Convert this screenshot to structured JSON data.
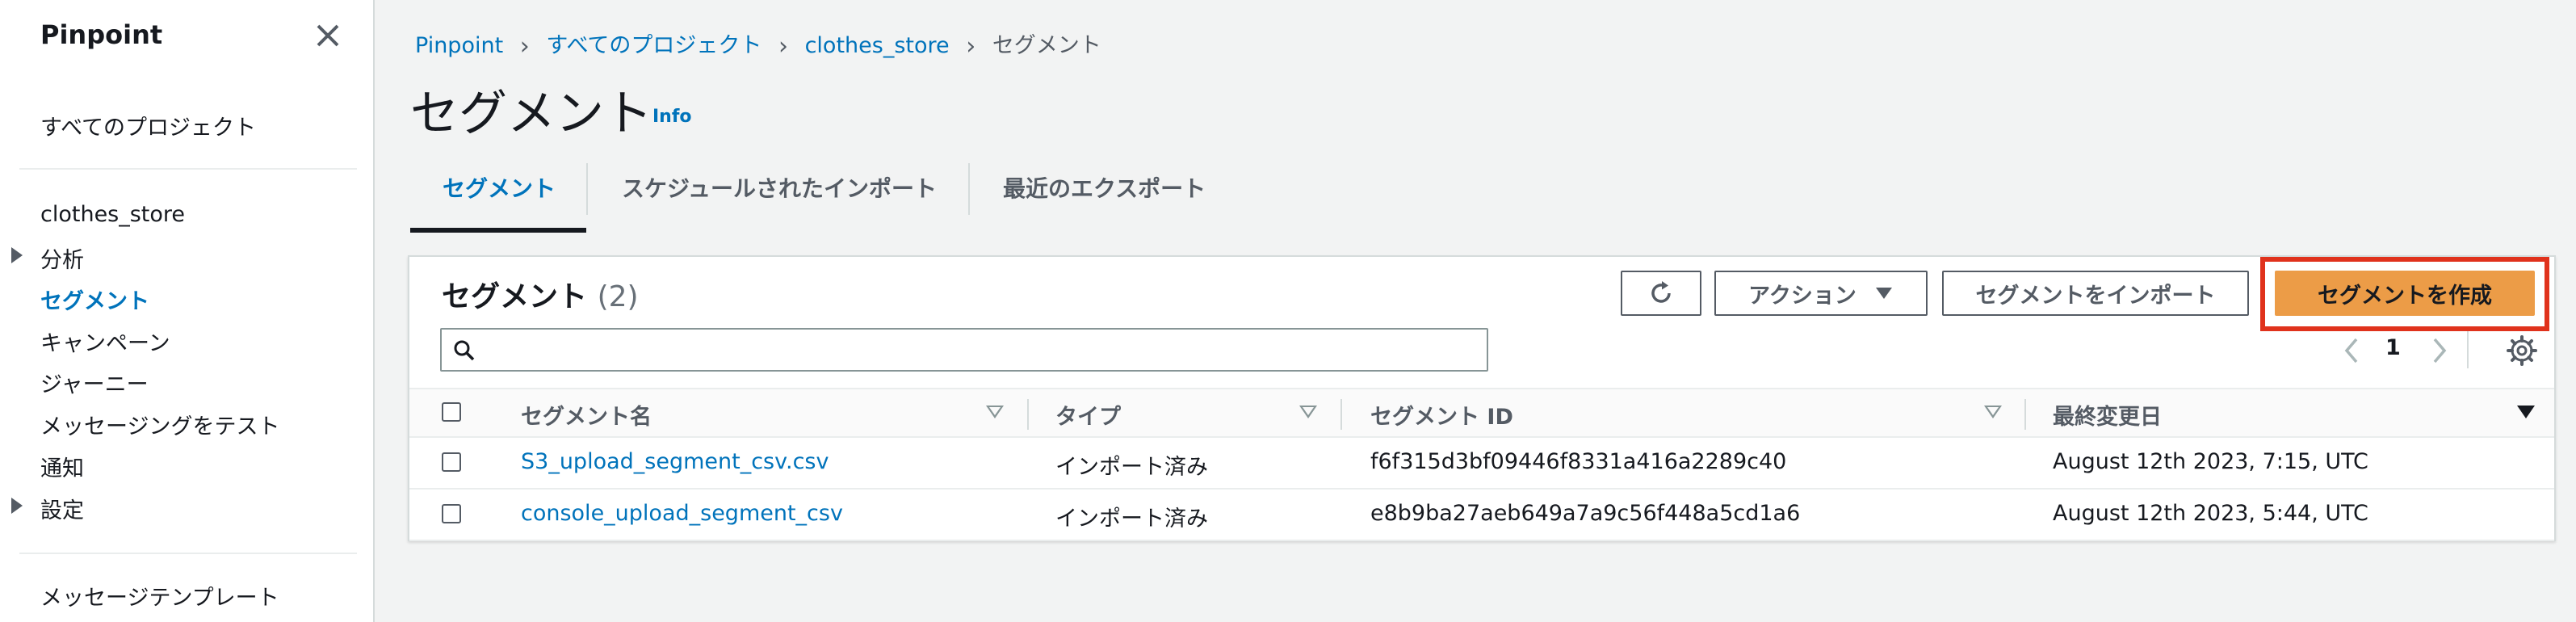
{
  "sidebar": {
    "title": "Pinpoint",
    "all_projects": "すべてのプロジェクト",
    "project_name": "clothes_store",
    "items": [
      {
        "label": "分析",
        "expandable": true
      },
      {
        "label": "セグメント",
        "active": true
      },
      {
        "label": "キャンペーン"
      },
      {
        "label": "ジャーニー"
      },
      {
        "label": "メッセージングをテスト"
      },
      {
        "label": "通知"
      },
      {
        "label": "設定",
        "expandable": true
      }
    ],
    "templates": "メッセージテンプレート"
  },
  "breadcrumb": [
    "Pinpoint",
    "すべてのプロジェクト",
    "clothes_store",
    "セグメント"
  ],
  "page": {
    "title": "セグメント",
    "info": "Info"
  },
  "tabs": [
    {
      "label": "セグメント",
      "active": true
    },
    {
      "label": "スケジュールされたインポート"
    },
    {
      "label": "最近のエクスポート"
    }
  ],
  "panel": {
    "title": "セグメント",
    "count": "(2)",
    "actions_label": "アクション",
    "import_label": "セグメントをインポート",
    "create_label": "セグメントを作成",
    "search_placeholder": "",
    "page_number": "1"
  },
  "table": {
    "columns": [
      "セグメント名",
      "タイプ",
      "セグメント ID",
      "最終変更日"
    ],
    "rows": [
      {
        "name": "S3_upload_segment_csv.csv",
        "type": "インポート済み",
        "id": "f6f315d3bf09446f8331a416a2289c40",
        "modified": "August 12th 2023, 7:15, UTC"
      },
      {
        "name": "console_upload_segment_csv",
        "type": "インポート済み",
        "id": "e8b9ba27aeb649a7a9c56f448a5cd1a6",
        "modified": "August 12th 2023, 5:44, UTC"
      }
    ]
  },
  "colors": {
    "accent": "#0073bb",
    "primary_button": "#ec9c47",
    "highlight": "#e0321c"
  }
}
